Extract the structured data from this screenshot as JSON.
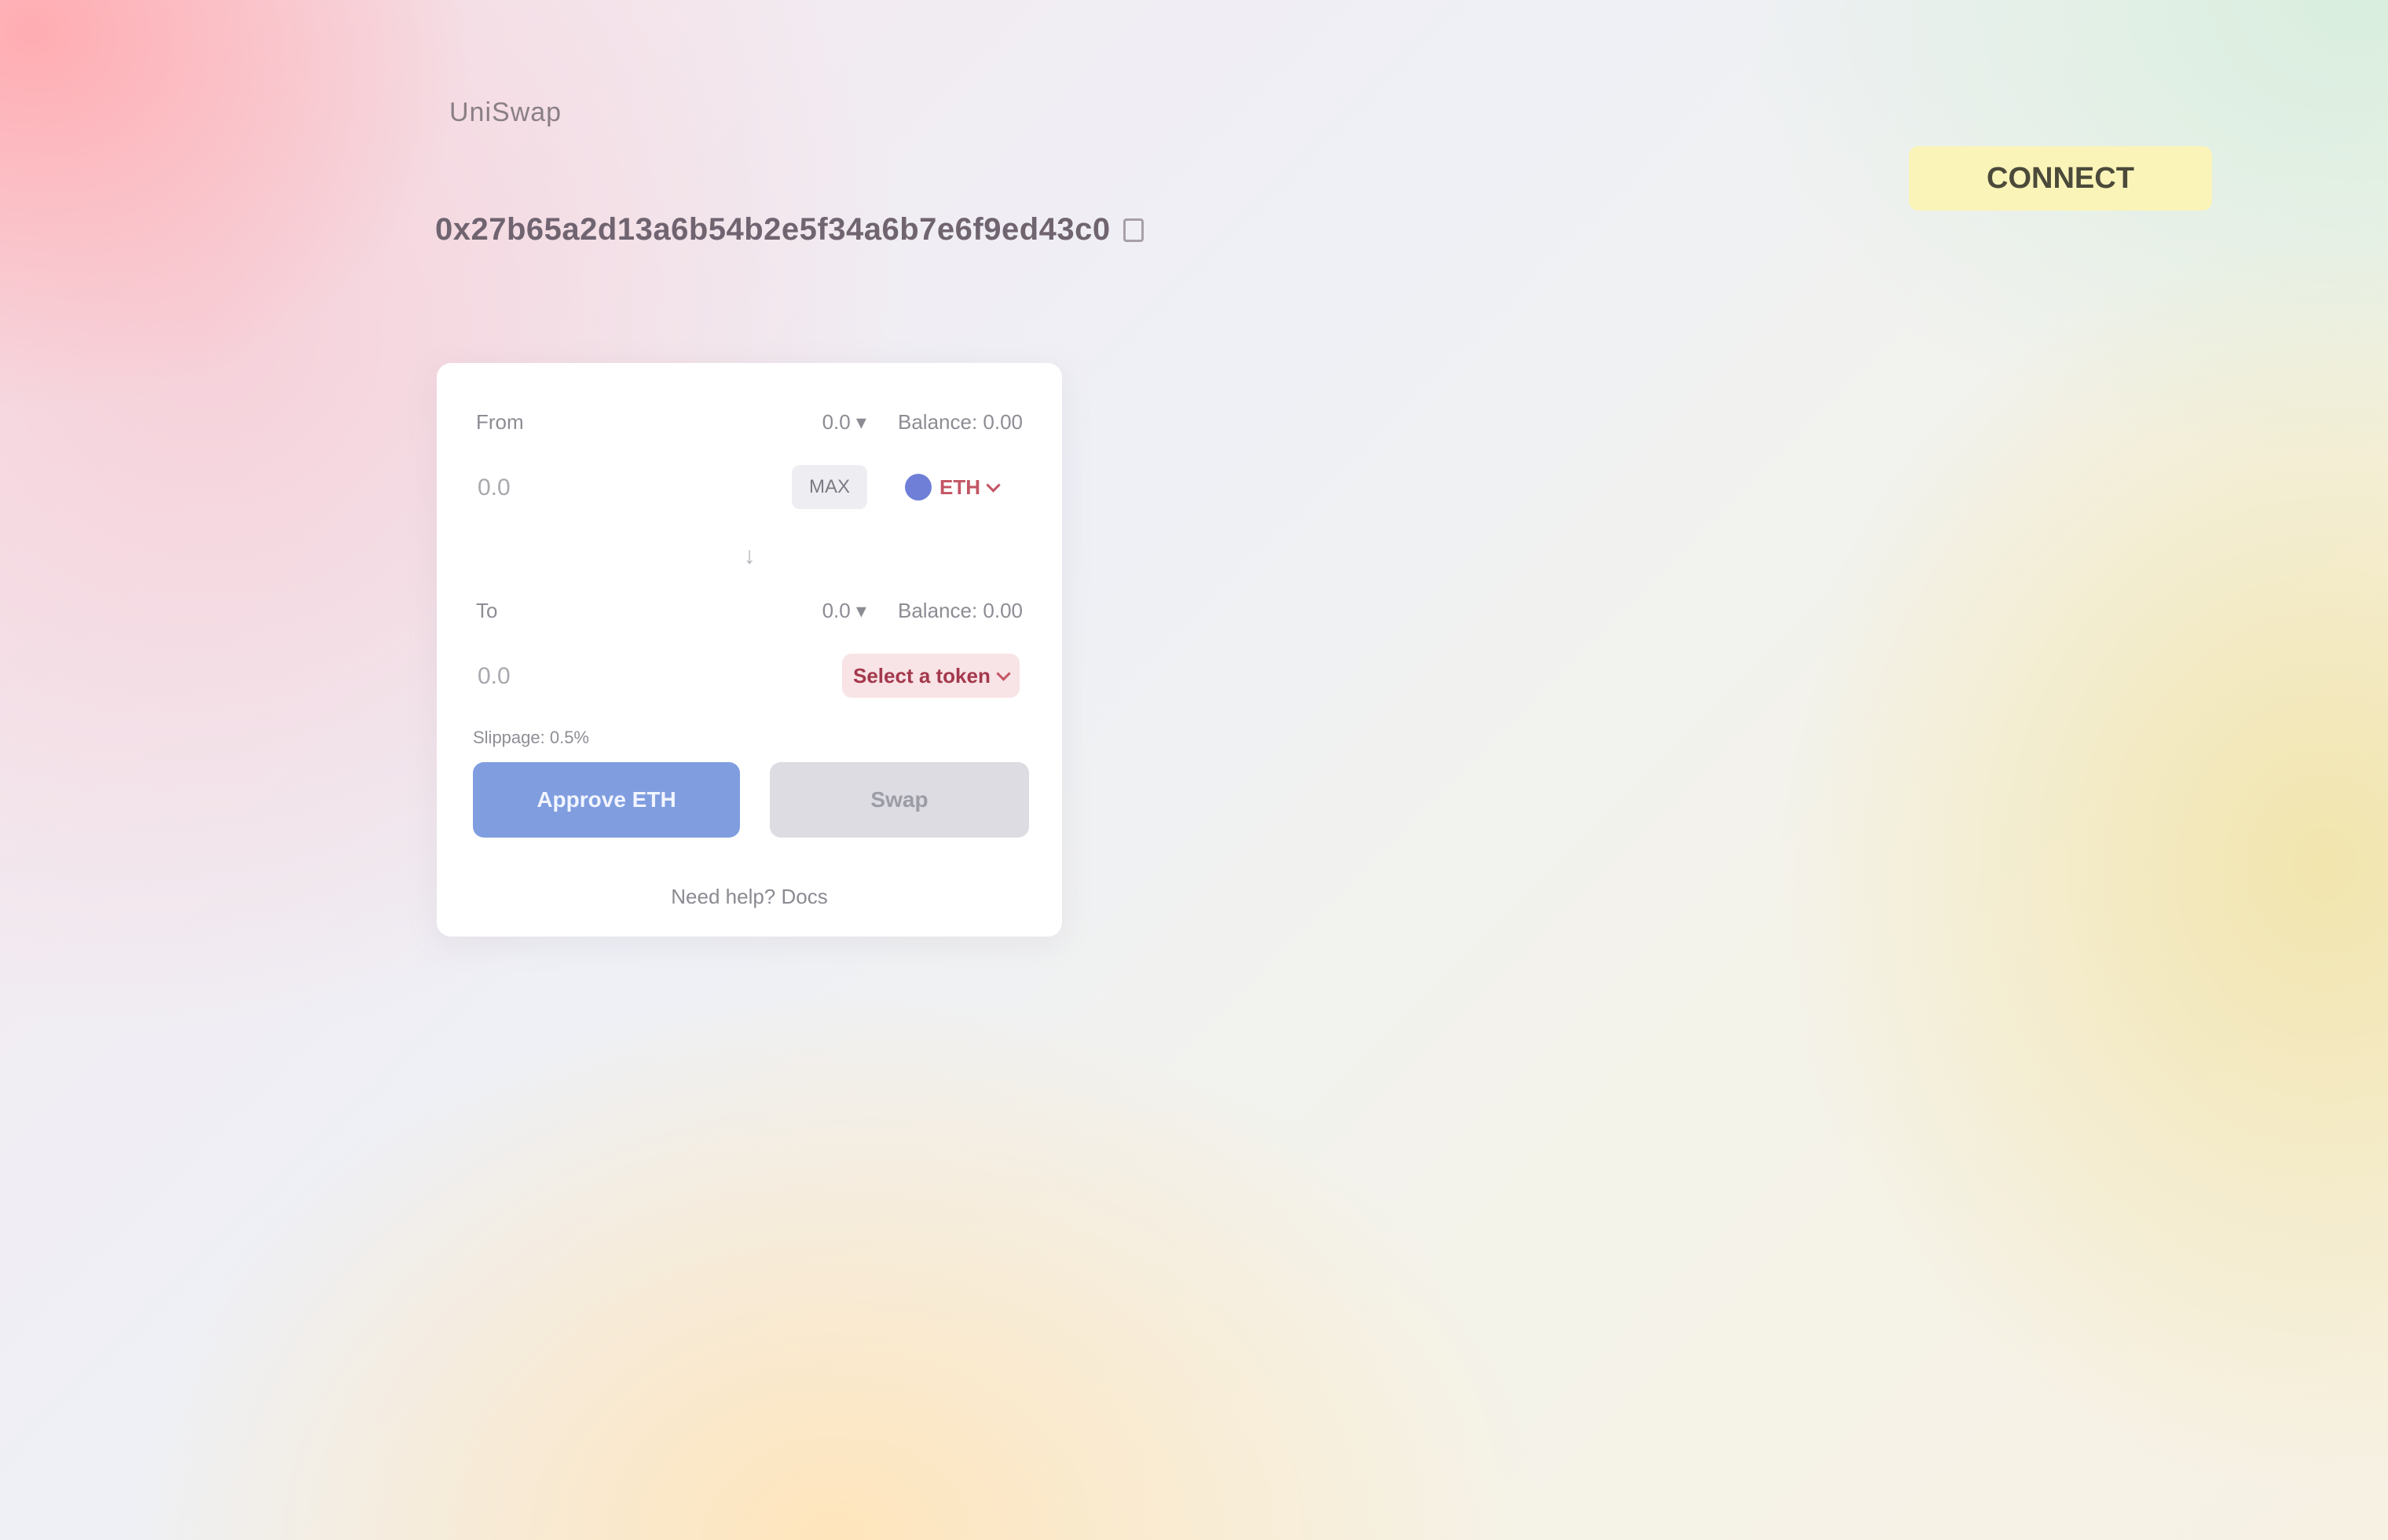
{
  "header": {
    "brand": "UniSwap",
    "address": "0x27b65a2d13a6b54b2e5f34a6b7e6f9ed43c0",
    "connect_label": "CONNECT"
  },
  "swap_card": {
    "from": {
      "label": "From",
      "balance_label": "0.0 ▾",
      "balance_value": "Balance: 0.00",
      "amount_placeholder": "0.0",
      "max_label": "MAX",
      "token": "ETH"
    },
    "to": {
      "label": "To",
      "balance_label": "0.0 ▾",
      "balance_value": "Balance: 0.00",
      "amount_placeholder": "0.0",
      "token": "Select a token"
    },
    "swap_arrow": "↓",
    "slippage": "Slippage: 0.5%",
    "approve_label": "Approve ETH",
    "swap_label": "Swap",
    "footer_link": "Need help? Docs"
  },
  "colors": {
    "accent": "#7f9ddf",
    "token_text": "#c35565",
    "connect_bg": "#fbf4b9"
  },
  "icons": [
    "copy-icon",
    "chevron-down-icon",
    "arrow-down-icon",
    "token-logo-icon"
  ]
}
